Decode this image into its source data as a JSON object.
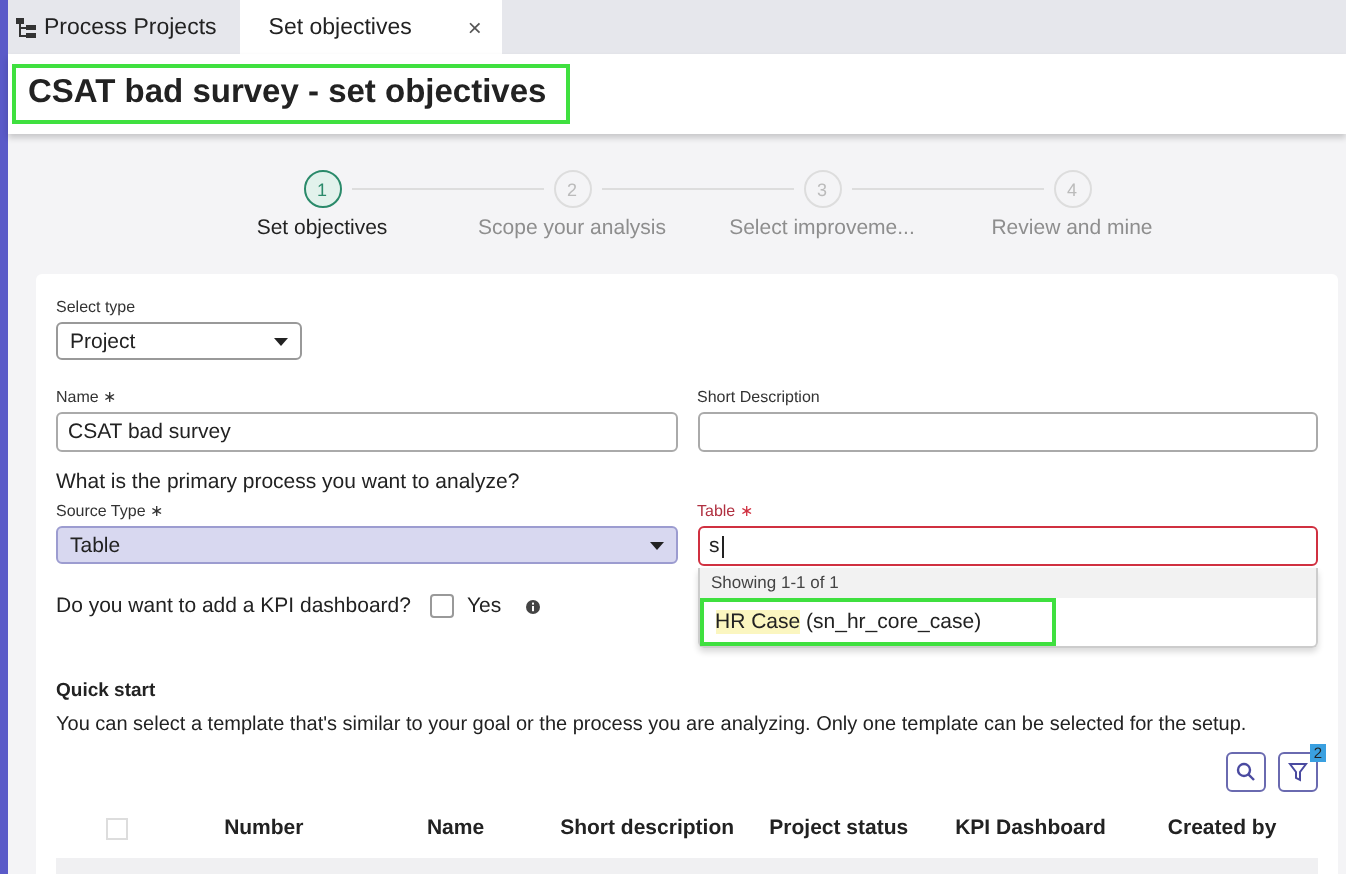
{
  "tabs": [
    {
      "label": "Process Projects",
      "selected": false,
      "closable": false,
      "kind": "list"
    },
    {
      "label": "Set objectives",
      "selected": true,
      "closable": true,
      "kind": "page"
    }
  ],
  "close_symbol": "×",
  "header": {
    "title": "CSAT bad survey - set objectives",
    "highlighted": true
  },
  "steps": [
    {
      "number": "1",
      "label": "Set objectives",
      "selected": true
    },
    {
      "number": "2",
      "label": "Scope your analysis",
      "selected": false
    },
    {
      "number": "3",
      "label": "Select improveme...",
      "selected": false
    },
    {
      "number": "4",
      "label": "Review and mine",
      "selected": false
    }
  ],
  "form": {
    "select_type": {
      "label": "Select type",
      "value": "Project"
    },
    "name": {
      "label": "Name",
      "required": true,
      "value": "CSAT bad survey"
    },
    "short_description": {
      "label": "Short Description"
    },
    "question": "What is the primary process you want to analyze?",
    "source_type": {
      "label": "Source Type",
      "required": true,
      "value": "Table"
    },
    "table": {
      "label": "Table",
      "required": true,
      "invalid": true,
      "value": "s",
      "results_note": "Showing 1-1 of 1",
      "options": [
        {
          "match": "HR Case",
          "rest": " (sn_hr_core_case)",
          "highlighted": true
        }
      ]
    },
    "kpi": {
      "question": "Do you want to add a KPI dashboard?",
      "checkbox_label": "Yes",
      "checked": false
    }
  },
  "quick_start": {
    "title": "Quick start",
    "description": "You can select a template that's similar to your goal or the process you are analyzing. Only one template can be selected for the setup.",
    "filter_count": "2",
    "select_all_checked": false,
    "columns": [
      "Number",
      "Name",
      "Short description",
      "Project status",
      "KPI Dashboard",
      "Created by"
    ]
  },
  "required_mark": "∗"
}
